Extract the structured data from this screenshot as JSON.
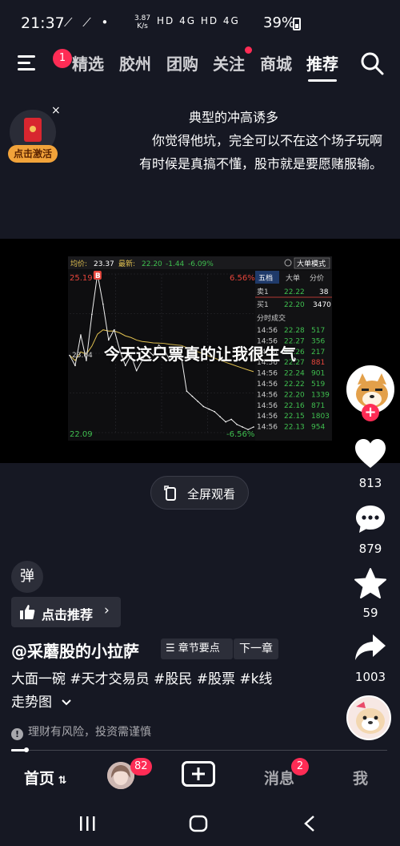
{
  "status_bar": {
    "time": "21:37",
    "icons_left": "⟋ ⟋ •",
    "net_speed_value": "3.87",
    "net_speed_unit": "K/s",
    "sys_icons": "HD 4G HD 4G",
    "battery": "39%"
  },
  "top_nav": {
    "menu_badge": "1",
    "tabs": [
      "精选",
      "胶州",
      "团购",
      "关注",
      "商城",
      "推荐"
    ],
    "active_tab": "推荐"
  },
  "red_packet": {
    "label": "点击激活",
    "close": "×"
  },
  "caption": {
    "line1": "典型的冲高诱多",
    "line2": "你觉得他坑，完全可以不在这个场子玩啊",
    "line3": "有时候是真搞不懂，股市就是要愿赌服输。"
  },
  "chart_panel": {
    "header_avg_label": "均价:",
    "header_avg_value": "23.37",
    "header_latest_label": "最新:",
    "header_latest_value": "22.20",
    "header_change": "-1.44",
    "header_pct": "-6.09%",
    "mode_button": "大单模式",
    "tabs": [
      "五档",
      "大单",
      "分价"
    ],
    "price_high": "25.19",
    "price_low": "22.09",
    "pct_high": "6.56%",
    "pct_low": "-6.56%",
    "mid_label": "23.64",
    "buy_marker": "B",
    "sell1": {
      "label": "卖1",
      "price": "22.22",
      "vol": "38"
    },
    "buy1": {
      "label": "买1",
      "price": "22.20",
      "vol": "3470"
    },
    "trades_title": "分时成交",
    "trades": [
      {
        "time": "14:56",
        "price": "22.28",
        "vol": "517",
        "color": "#3fbf4f"
      },
      {
        "time": "14:56",
        "price": "22.27",
        "vol": "356",
        "color": "#3fbf4f"
      },
      {
        "time": "14:56",
        "price": "22.26",
        "vol": "217",
        "color": "#3fbf4f"
      },
      {
        "time": "14:56",
        "price": "22.27",
        "vol": "881",
        "color": "#e8463c"
      },
      {
        "time": "14:56",
        "price": "22.24",
        "vol": "901",
        "color": "#3fbf4f"
      },
      {
        "time": "14:56",
        "price": "22.22",
        "vol": "519",
        "color": "#3fbf4f"
      },
      {
        "time": "14:56",
        "price": "22.20",
        "vol": "1339",
        "color": "#3fbf4f"
      },
      {
        "time": "14:56",
        "price": "22.16",
        "vol": "871",
        "color": "#3fbf4f"
      },
      {
        "time": "14:56",
        "price": "22.15",
        "vol": "1803",
        "color": "#3fbf4f"
      },
      {
        "time": "14:56",
        "price": "22.13",
        "vol": "954",
        "color": "#3fbf4f"
      }
    ],
    "chart_data": {
      "type": "line",
      "series": [
        {
          "name": "",
          "values": [
            23.6,
            23.4,
            24.0,
            23.5,
            24.4,
            25.19,
            24.6,
            23.9,
            24.1,
            23.7,
            23.4,
            23.6,
            23.3,
            23.5,
            23.7,
            23.6,
            23.8,
            23.7,
            23.5,
            23.6,
            23.6,
            22.9,
            22.8,
            22.7,
            22.6,
            22.55,
            22.5,
            22.4,
            22.3,
            22.35,
            22.25,
            22.2,
            22.15,
            22.2
          ]
        }
      ],
      "ylim": [
        22.09,
        25.19
      ]
    }
  },
  "overlay_text": "今天这只票真的让我很生气",
  "fullscreen_label": "全屏观看",
  "rail": {
    "likes": "813",
    "comments": "879",
    "favorites": "59",
    "shares": "1003"
  },
  "danmu_label": "弹",
  "recommend_label": "点击推荐",
  "author": "@采蘑股的小拉萨",
  "chapter_label": "章节要点",
  "next_chapter": "下一章",
  "description_line1": "大面一碗 #天才交易员 #股民 #股票 #k线",
  "description_line2": "走势图",
  "risk_text": "理财有风险，投资需谨慎",
  "progress": 0.04,
  "bottom_tabs": {
    "home": "首页",
    "friends_badge": "82",
    "messages": "消息",
    "messages_badge": "2",
    "me": "我"
  }
}
